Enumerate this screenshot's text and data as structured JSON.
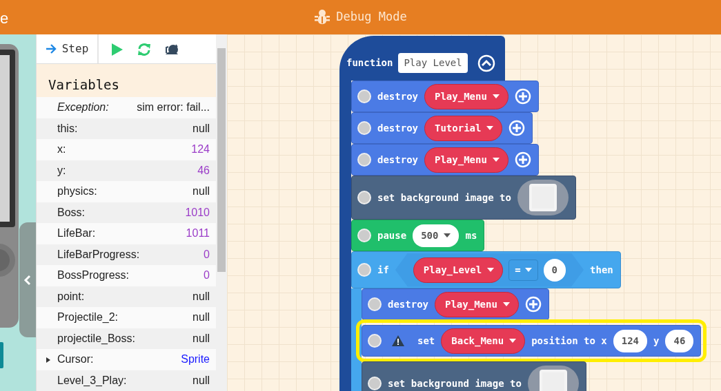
{
  "header": {
    "left_text": "e",
    "title": "Debug Mode"
  },
  "debugger": {
    "step_label": "Step",
    "variables_title": "Variables",
    "variables": [
      {
        "name": "Exception:",
        "value": "sim error: fail...",
        "kind": "error"
      },
      {
        "name": "this:",
        "value": "null",
        "kind": "null"
      },
      {
        "name": "x:",
        "value": "124",
        "kind": "number"
      },
      {
        "name": "y:",
        "value": "46",
        "kind": "number"
      },
      {
        "name": "physics:",
        "value": "null",
        "kind": "null"
      },
      {
        "name": "Boss:",
        "value": "1010",
        "kind": "number"
      },
      {
        "name": "LifeBar:",
        "value": "1011",
        "kind": "number"
      },
      {
        "name": "LifeBarProgress:",
        "value": "0",
        "kind": "number"
      },
      {
        "name": "BossProgress:",
        "value": "0",
        "kind": "number"
      },
      {
        "name": "point:",
        "value": "null",
        "kind": "null"
      },
      {
        "name": "Projectile_2:",
        "value": "null",
        "kind": "null"
      },
      {
        "name": "projectile_Boss:",
        "value": "null",
        "kind": "null"
      },
      {
        "name": "Cursor:",
        "value": "Sprite",
        "kind": "object"
      },
      {
        "name": "Level_3_Play:",
        "value": "null",
        "kind": "null"
      }
    ]
  },
  "workspace": {
    "function": {
      "keyword": "function",
      "name": "Play Level",
      "statements": [
        {
          "kind": "sprite",
          "warning": false,
          "highlighted": false,
          "parts": [
            {
              "kind": "text",
              "text": "destroy"
            },
            {
              "kind": "dropdown",
              "text": "Play_Menu"
            },
            {
              "kind": "plus"
            }
          ]
        },
        {
          "kind": "sprite",
          "warning": false,
          "highlighted": false,
          "parts": [
            {
              "kind": "text",
              "text": "destroy"
            },
            {
              "kind": "dropdown",
              "text": "Tutorial"
            },
            {
              "kind": "plus"
            }
          ]
        },
        {
          "kind": "sprite",
          "warning": false,
          "highlighted": false,
          "parts": [
            {
              "kind": "text",
              "text": "destroy"
            },
            {
              "kind": "dropdown",
              "text": "Play_Menu"
            },
            {
              "kind": "plus"
            }
          ]
        },
        {
          "kind": "scene",
          "warning": false,
          "highlighted": false,
          "parts": [
            {
              "kind": "text",
              "text": "set background image to"
            },
            {
              "kind": "image"
            }
          ]
        },
        {
          "kind": "loops",
          "warning": false,
          "highlighted": false,
          "parts": [
            {
              "kind": "text",
              "text": "pause"
            },
            {
              "kind": "number_dropdown",
              "text": "500"
            },
            {
              "kind": "text",
              "text": "ms"
            }
          ]
        },
        {
          "kind": "if",
          "warning": false,
          "highlighted": false,
          "parts": [
            {
              "kind": "text",
              "text": "if"
            },
            {
              "kind": "condition",
              "parts": [
                {
                  "kind": "dropdown",
                  "text": "Play_Level"
                },
                {
                  "kind": "operator",
                  "text": "="
                },
                {
                  "kind": "number",
                  "text": "0"
                }
              ]
            },
            {
              "kind": "text",
              "text": "then"
            }
          ],
          "children": [
            {
              "kind": "sprite",
              "warning": false,
              "highlighted": false,
              "parts": [
                {
                  "kind": "text",
                  "text": "destroy"
                },
                {
                  "kind": "dropdown",
                  "text": "Play_Menu"
                },
                {
                  "kind": "plus"
                }
              ]
            },
            {
              "kind": "sprite",
              "warning": true,
              "highlighted": true,
              "parts": [
                {
                  "kind": "text",
                  "text": "set"
                },
                {
                  "kind": "dropdown",
                  "text": "Back_Menu"
                },
                {
                  "kind": "text",
                  "text": "position to x"
                },
                {
                  "kind": "number",
                  "text": "124"
                },
                {
                  "kind": "text",
                  "text": "y"
                },
                {
                  "kind": "number",
                  "text": "46"
                }
              ]
            },
            {
              "kind": "scene",
              "warning": false,
              "highlighted": false,
              "parts": [
                {
                  "kind": "text",
                  "text": "set background image to"
                },
                {
                  "kind": "image"
                }
              ]
            }
          ]
        }
      ]
    }
  }
}
